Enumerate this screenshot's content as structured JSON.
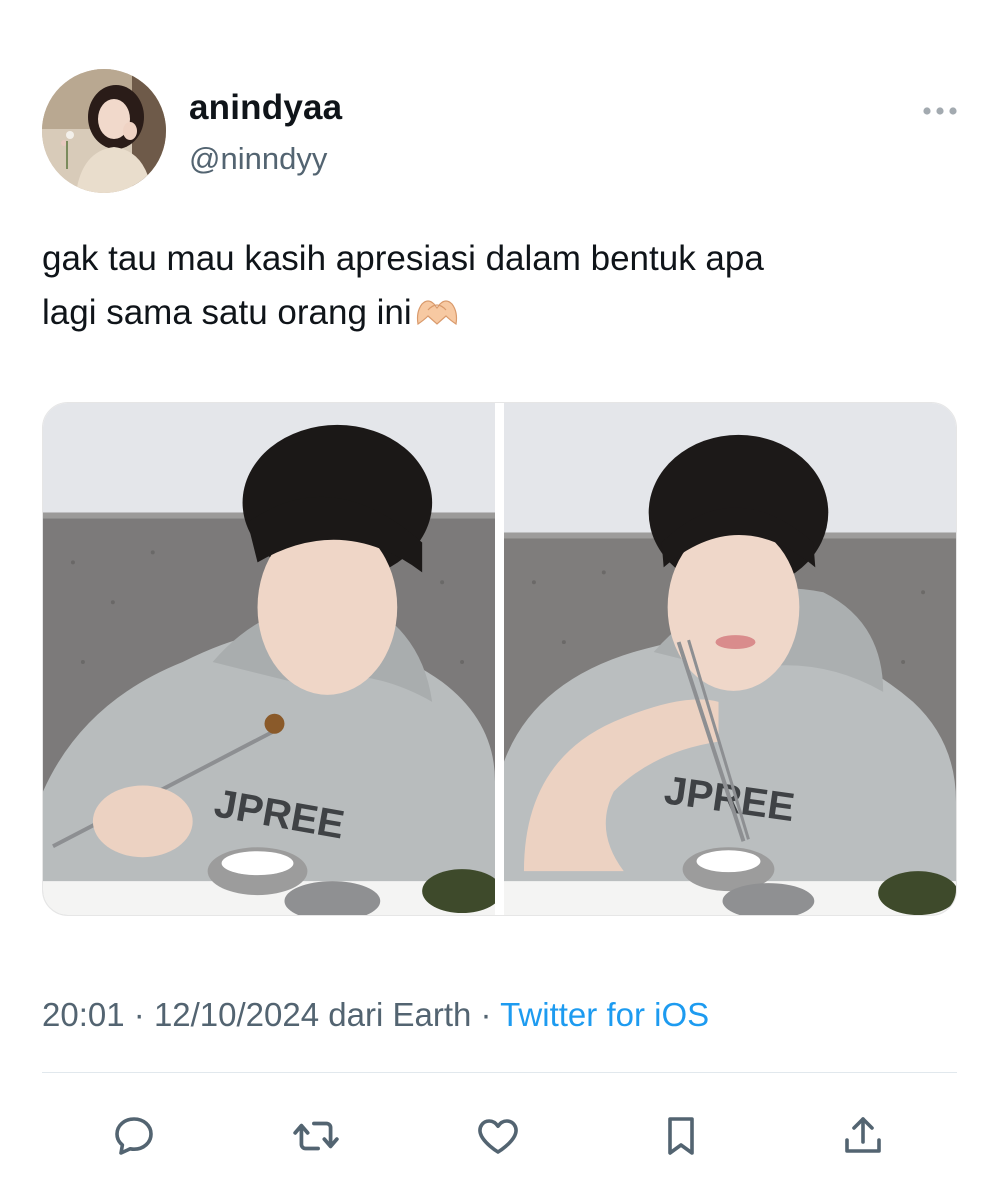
{
  "author": {
    "display_name": "anindyaa",
    "handle": "@ninndyy",
    "avatar_icon": "profile-photo"
  },
  "tweet": {
    "text_line_1": "gak tau mau kasih apresiasi dalam bentuk apa",
    "text_line_2": "lagi sama satu orang ini",
    "emoji": "heart-hands-emoji",
    "media": [
      {
        "icon": "photo-man-eating-with-chopsticks"
      },
      {
        "icon": "photo-man-holding-chopsticks"
      }
    ]
  },
  "meta": {
    "time": "20:01",
    "separator": "·",
    "date_location": "12/10/2024 dari Earth",
    "source": "Twitter for iOS"
  },
  "actions": [
    {
      "icon": "reply-icon"
    },
    {
      "icon": "retweet-icon"
    },
    {
      "icon": "like-icon"
    },
    {
      "icon": "bookmark-icon"
    },
    {
      "icon": "share-icon"
    }
  ],
  "colors": {
    "text": "#0f1419",
    "secondary": "#536471",
    "link": "#1d9bf0",
    "icon": "#536471"
  }
}
